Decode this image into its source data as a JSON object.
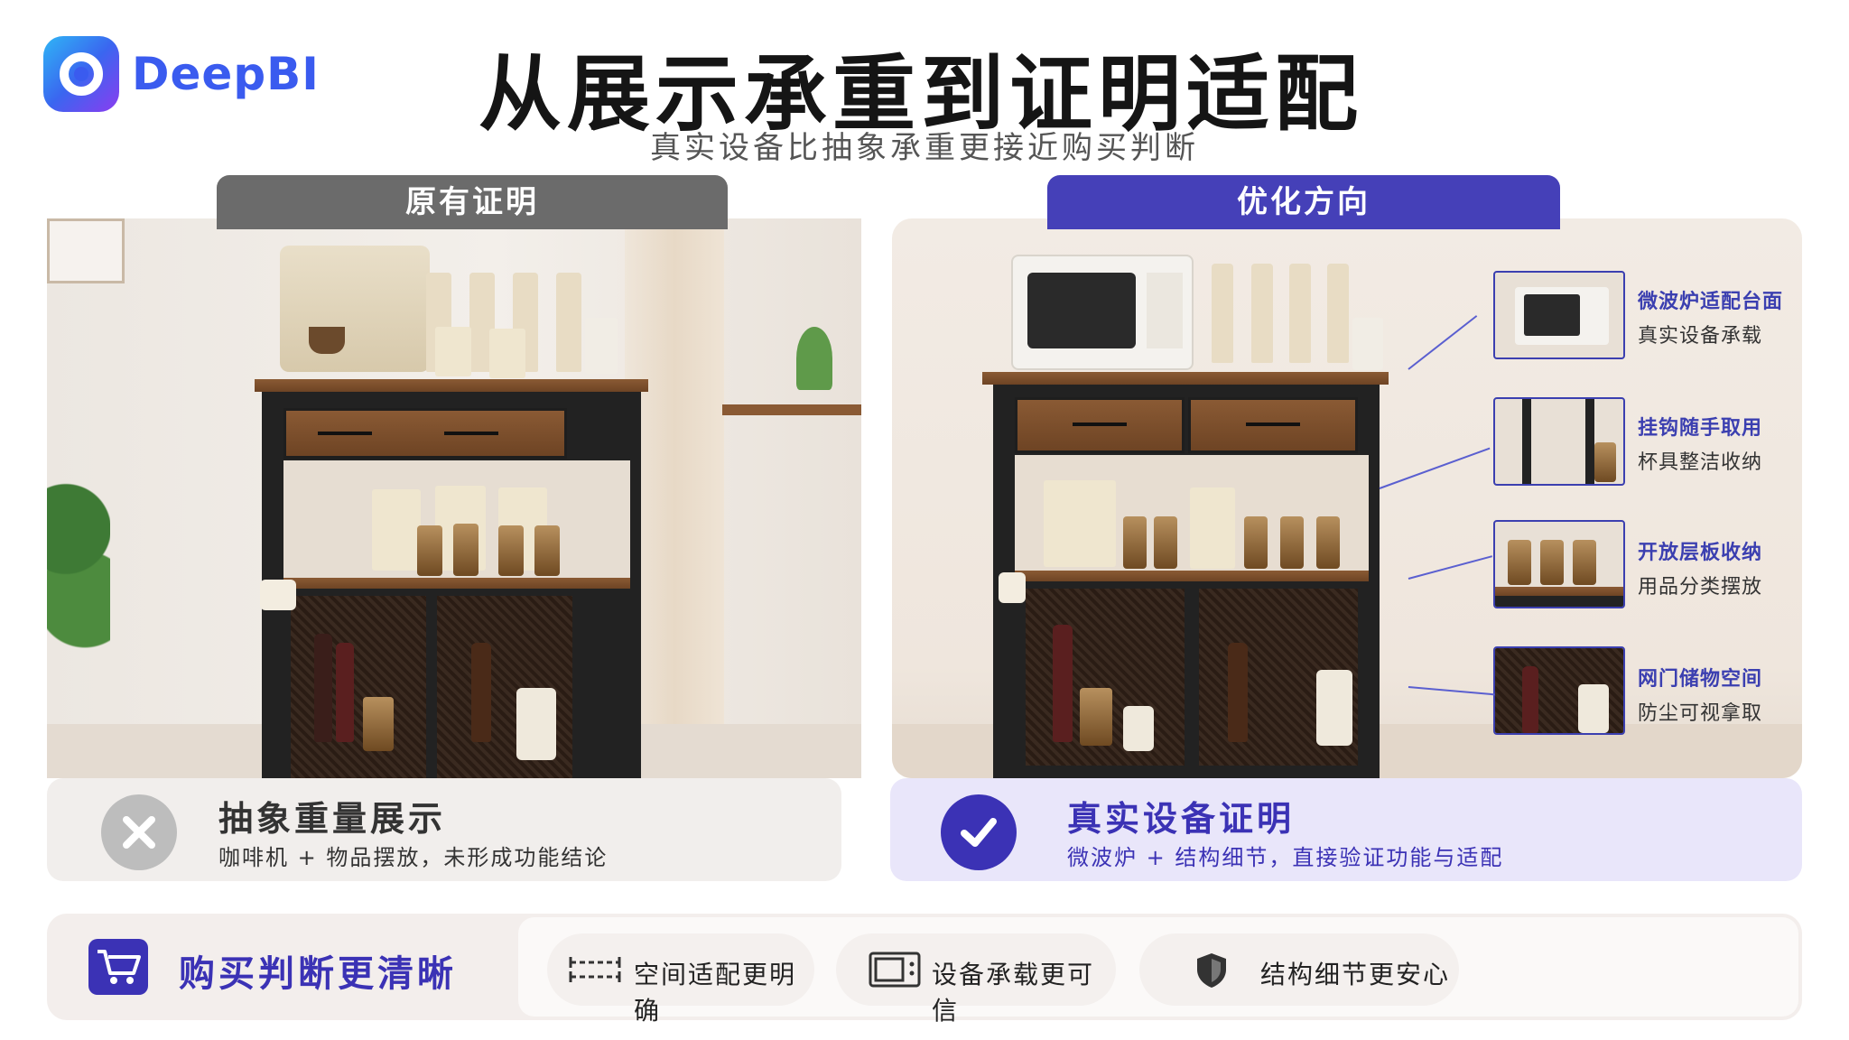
{
  "brand": {
    "name": "DeepBI"
  },
  "header": {
    "title": "从展示承重到证明适配",
    "subtitle": "真实设备比抽象承重更接近购买判断"
  },
  "left_panel": {
    "tab": "原有证明",
    "verdict_title": "抽象重量展示",
    "verdict_desc": "咖啡机 + 物品摆放，未形成功能结论",
    "verdict_icon": "x-icon"
  },
  "right_panel": {
    "tab": "优化方向",
    "verdict_title": "真实设备证明",
    "verdict_desc": "微波炉 + 结构细节，直接验证功能与适配",
    "verdict_icon": "check-icon",
    "callouts": [
      {
        "title": "微波炉适配台面",
        "desc": "真实设备承载"
      },
      {
        "title": "挂钩随手取用",
        "desc": "杯具整洁收纳"
      },
      {
        "title": "开放层板收纳",
        "desc": "用品分类摆放"
      },
      {
        "title": "网门储物空间",
        "desc": "防尘可视拿取"
      }
    ]
  },
  "bottom": {
    "title": "购买判断更清晰",
    "pills": [
      {
        "label": "空间适配更明确",
        "icon": "dimension-arrows-icon"
      },
      {
        "label": "设备承载更可信",
        "icon": "microwave-icon"
      },
      {
        "label": "结构细节更安心",
        "icon": "shield-icon"
      }
    ]
  },
  "colors": {
    "accent": "#3b32b5",
    "muted_tab": "#6b6b6b",
    "brand": "#3a5bef"
  }
}
